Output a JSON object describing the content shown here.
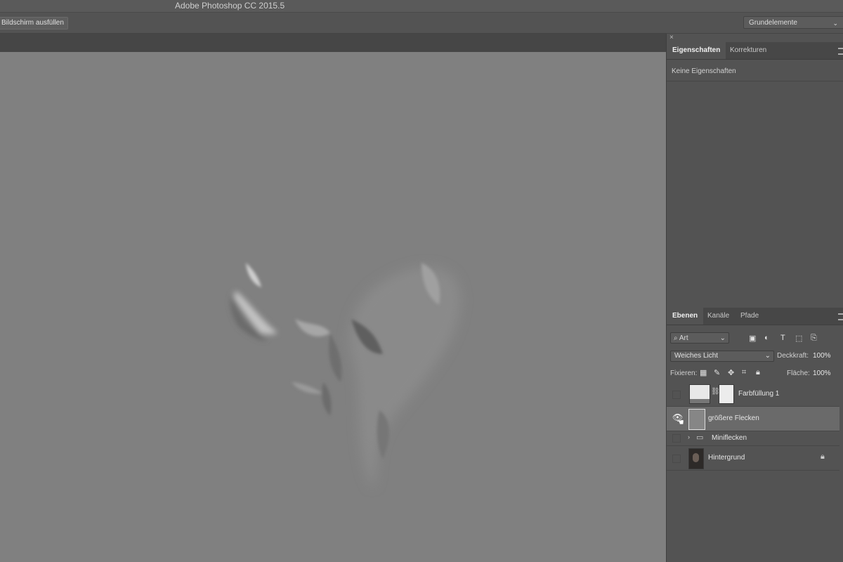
{
  "app": {
    "title": "Adobe Photoshop CC 2015.5"
  },
  "options_bar": {
    "fit_screen_label": "Bildschirm ausfüllen",
    "workspace": "Grundelemente"
  },
  "properties_panel": {
    "close_glyph": "×",
    "tabs": [
      {
        "label": "Eigenschaften",
        "active": true
      },
      {
        "label": "Korrekturen",
        "active": false
      }
    ],
    "content": "Keine Eigenschaften"
  },
  "layers_panel": {
    "tabs": [
      {
        "label": "Ebenen",
        "active": true
      },
      {
        "label": "Kanäle",
        "active": false
      },
      {
        "label": "Pfade",
        "active": false
      }
    ],
    "filter_kind": "Art",
    "blend_mode": "Weiches Licht",
    "opacity_label": "Deckkraft:",
    "opacity_value": "100%",
    "lock_label": "Fixieren:",
    "fill_label": "Fläche:",
    "fill_value": "100%",
    "layers": [
      {
        "name": "Farbfüllung 1",
        "visible": false,
        "selected": false,
        "type": "fill"
      },
      {
        "name": "größere Flecken",
        "visible": true,
        "selected": true,
        "type": "pixel"
      },
      {
        "name": "Miniflecken",
        "visible": false,
        "selected": false,
        "type": "group"
      },
      {
        "name": "Hintergrund",
        "visible": false,
        "selected": false,
        "type": "background",
        "locked": true
      }
    ]
  },
  "icons": [
    "search-icon",
    "image-filter-icon",
    "adjustment-filter-icon",
    "type-filter-icon",
    "shape-filter-icon",
    "smart-object-filter-icon",
    "lock-transparent-icon",
    "lock-pixels-icon",
    "lock-position-icon",
    "lock-artboard-icon",
    "lock-all-icon",
    "eye-icon",
    "hand-cursor-icon",
    "folder-icon",
    "link-icon",
    "lock-icon"
  ],
  "colors": {
    "canvas": "#808080",
    "panel": "#535353",
    "selected_row": "#6a6a6a"
  }
}
